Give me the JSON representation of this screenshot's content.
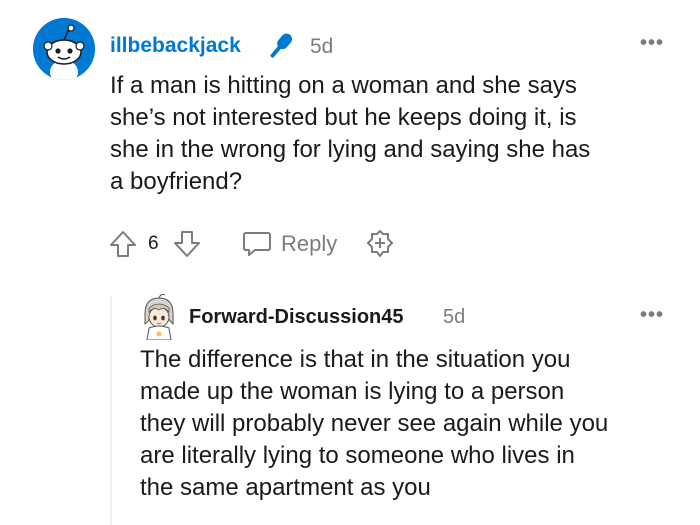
{
  "top_comment": {
    "username": "illbebackjack",
    "flair_icon": "microphone-icon",
    "age": "5d",
    "more_label": "•••",
    "text": "If a man is hitting on a woman and she says\nshe’s not interested but he keeps doing it, is\nshe in the wrong for lying and saying she has\na boyfriend?",
    "vote_count": "6",
    "reply_label": "Reply"
  },
  "reply_comment": {
    "username": "Forward-Discussion45",
    "age": "5d",
    "more_label": "•••",
    "text": "The difference is that in the situation you\nmade up the woman is lying to a person\nthey will probably never see again while you\nare literally lying to someone who lives in\nthe same apartment as you"
  },
  "colors": {
    "username_blue": "#0079d3",
    "meta_gray": "#7c7c7c",
    "text_dark": "#1a1a1b"
  }
}
